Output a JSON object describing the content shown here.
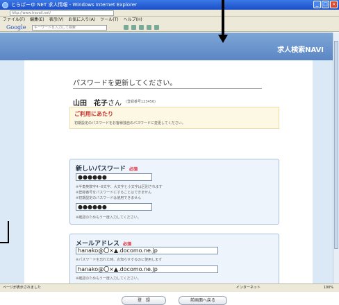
{
  "window": {
    "title": "とらばーゆ NET 求人情報 - Windows Internet Explorer",
    "address": "http://www.travail.net/"
  },
  "menu": [
    "ファイル(F)",
    "編集(E)",
    "表示(V)",
    "お気に入り(A)",
    "ツール(T)",
    "ヘルプ(H)"
  ],
  "google": {
    "logo": "Google",
    "search_placeholder": "キーワードを入力して検索"
  },
  "site": {
    "brand": "求人検索NAVI"
  },
  "form": {
    "title": "パスワードを更新してください。",
    "user_name": "山田　花子",
    "honorific": "さん",
    "user_id": "(登録番号123456)",
    "notice_heading": "ご利用にあたり",
    "notice_text": "初期設定のパスワードをお客様独自のパスワードに変更してください。",
    "password_section": "新しいパスワード",
    "required_label": "必須",
    "password_value": "●●●●●●",
    "password_hint_1": "※半角英数字4~8文字、大文字と小文字は区別されます",
    "password_hint_2": "※登録番号をパスワードにすることはできません",
    "password_hint_3": "※初期設定のパスワードは使用できません",
    "password_confirm_value": "●●●●●●",
    "confirm_hint": "※確認のためもう一度入力してください。",
    "email_section": "メールアドレス",
    "email_value": "hanako@〇×▲.docomo.ne.jp",
    "email_hint": "※パスワードを忘れた時、お知らせするのに使用します",
    "email_confirm_value": "hanako@〇×▲.docomo.ne.jp",
    "email_confirm_hint": "※確認のためもう一度入力してください。",
    "submit_label": "登　録",
    "back_label": "前画面へ戻る"
  },
  "status": {
    "left": "ページが表示されました",
    "zone": "インターネット",
    "zoom": "100%"
  }
}
